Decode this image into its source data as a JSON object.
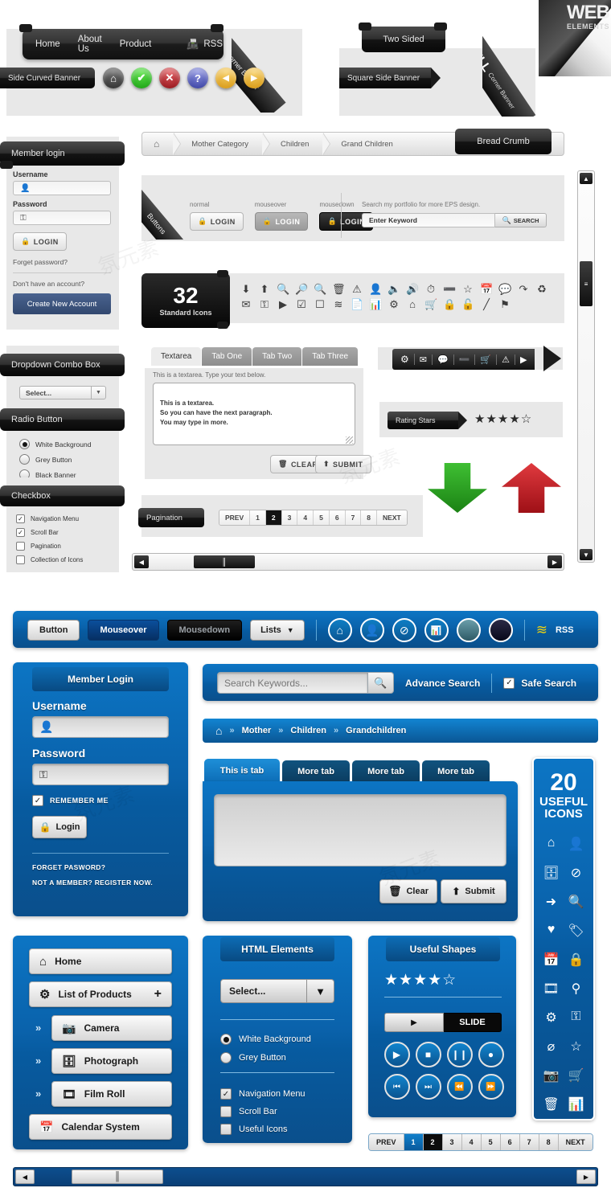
{
  "corner": {
    "title_line1": "WEB",
    "title_line2": "ELEMENTS"
  },
  "grey_kit": {
    "topnav": {
      "items": [
        "Home",
        "About Us",
        "Product"
      ],
      "rss_label": "RSS",
      "rss_icon": "rss-icon"
    },
    "banners": {
      "side_curved": "Side Curved Banner",
      "corner_left": "Corner Banner",
      "two_sided": "Two Sided",
      "square_side": "Square Side Banner",
      "corner_right_big": "FULL",
      "corner_right_small": "Corner Banner"
    },
    "circle_buttons": [
      {
        "name": "home-icon",
        "glyph": "⌂",
        "color": "#4a4a4a"
      },
      {
        "name": "check-icon",
        "glyph": "✔",
        "color": "#22b520"
      },
      {
        "name": "close-icon",
        "glyph": "✕",
        "color": "#a81b20"
      },
      {
        "name": "question-icon",
        "glyph": "?",
        "color": "#4a52b0"
      },
      {
        "name": "prev-icon",
        "glyph": "◀",
        "color": "#e2a51a"
      },
      {
        "name": "next-icon",
        "glyph": "▶",
        "color": "#e2a51a"
      }
    ],
    "login_panel": {
      "title": "Member login",
      "username_label": "Username",
      "username_icon": "user-icon",
      "password_label": "Password",
      "password_icon": "key-icon",
      "login_button": "LOGIN",
      "login_icon": "lock-icon",
      "forgot": "Forget password?",
      "no_account": "Don't have an account?",
      "create_account": "Create New Account",
      "accent": "#3a5488"
    },
    "dropdown": {
      "title": "Dropdown Combo Box",
      "value": "Select...",
      "arrow_icon": "chevron-down-icon"
    },
    "radio": {
      "title": "Radio Button",
      "options": [
        "White Background",
        "Grey Button",
        "Black Banner"
      ],
      "selected_index": 0
    },
    "checkbox": {
      "title": "Checkbox",
      "options": [
        {
          "label": "Navigation Menu",
          "checked": true
        },
        {
          "label": "Scroll Bar",
          "checked": true
        },
        {
          "label": "Pagination",
          "checked": false
        },
        {
          "label": "Collection of Icons",
          "checked": false
        }
      ]
    },
    "breadcrumb": {
      "home_icon": "home-icon",
      "items": [
        "Mother Category",
        "Children",
        "Grand Children"
      ],
      "tag": "Bread Crumb"
    },
    "buttons_block": {
      "ribbon": "Buttons",
      "states": [
        "normal",
        "mouseover",
        "mousedown"
      ],
      "button_label": "LOGIN",
      "search_caption": "Search my portfolio for more EPS design.",
      "search_placeholder": "Enter Keyword",
      "search_button": "SEARCH",
      "search_icon": "search-icon"
    },
    "icons32": {
      "count": "32",
      "caption": "Standard Icons",
      "glyphs": [
        "⬇",
        "⬆",
        "⊕",
        "⊖",
        "⚲",
        "🗑",
        "⚠",
        "♟",
        "🔊",
        "◂",
        "◴",
        "⊖",
        "☆",
        "📅",
        "💬",
        "↷",
        "♻",
        "✉",
        "⚷",
        "▶",
        "☑",
        "☐",
        "≋",
        "📄",
        "‖",
        "⚙",
        "⌂",
        "🛒",
        "🔒",
        "🔓",
        "∕",
        "⚑"
      ]
    },
    "textarea_block": {
      "tabs": [
        "Textarea",
        "Tab One",
        "Tab Two",
        "Tab Three"
      ],
      "active_tab": 0,
      "caption": "This is a textarea. Type your text below.",
      "value": "This is a textarea.\nSo you can have the next paragraph.\nYou may type in more.",
      "clear_label": "CLEAR",
      "clear_icon": "trash-icon",
      "submit_label": "SUBMIT",
      "submit_icon": "up-arrow-icon"
    },
    "nav_strip_icons": [
      "gear-icon",
      "mail-icon",
      "comment-icon",
      "minus-icon",
      "cart-icon",
      "warning-icon",
      "play-icon"
    ],
    "nav_strip_glyphs": [
      "⚙",
      "✉",
      "💬",
      "⊖",
      "🛒",
      "⚠",
      "▶"
    ],
    "rating": {
      "label": "Rating Stars",
      "value": 3.5,
      "max": 5
    },
    "arrows": {
      "down_color": "#2fae28",
      "up_color": "#c42026"
    },
    "pagination": {
      "label": "Pagination",
      "prev": "PREV",
      "next": "NEXT",
      "pages": [
        "1",
        "2",
        "3",
        "4",
        "5",
        "6",
        "7",
        "8"
      ],
      "current": "2"
    }
  },
  "blue_kit": {
    "toolbar": {
      "buttons": [
        "Button",
        "Mouseover",
        "Mousedown"
      ],
      "list_label": "Lists",
      "list_icon": "chevron-down-icon",
      "icons": [
        "home-icon",
        "user-icon",
        "no-entry-icon",
        "chart-icon",
        "circle-teal-icon",
        "circle-dark-icon"
      ],
      "icon_glyphs": [
        "⌂",
        "👤",
        "⊘",
        "📊",
        "",
        ""
      ],
      "rss_label": "RSS",
      "rss_icon": "rss-icon",
      "rss_color": "#f2d40c"
    },
    "login": {
      "title": "Member Login",
      "username_label": "Username",
      "username_icon": "user-icon",
      "password_label": "Password",
      "password_icon": "key-icon",
      "remember_label": "REMEMBER ME",
      "remember_checked": true,
      "login_button": "Login",
      "login_icon": "lock-icon",
      "forgot": "FORGET PASWORD?",
      "register": "NOT A MEMBER? REGISTER NOW."
    },
    "search": {
      "placeholder": "Search Keywords...",
      "search_icon": "search-icon",
      "advance_label": "Advance Search",
      "safe_label": "Safe Search",
      "safe_checked": true
    },
    "breadcrumb": {
      "home_icon": "home-icon",
      "separator": "»",
      "items": [
        "Mother",
        "Children",
        "Grandchildren"
      ]
    },
    "tabs_panel": {
      "tabs": [
        "This is tab",
        "More tab",
        "More tab",
        "More tab"
      ],
      "active_tab": 0,
      "textarea_value": "",
      "clear_label": "Clear",
      "clear_icon": "trash-icon",
      "submit_label": "Submit",
      "submit_icon": "up-arrow-icon"
    },
    "useful_icons": {
      "count": "20",
      "line1": "USEFUL",
      "line2": "ICONS",
      "names": [
        "home-icon",
        "user-icon",
        "photo-upload-icon",
        "no-entry-icon",
        "arrow-right-icon",
        "search-icon",
        "heart-icon",
        "tag-icon",
        "calendar-icon",
        "lock-icon",
        "film-roll-icon",
        "sitemap-icon",
        "gear-icon",
        "key-icon",
        "block-icon",
        "star-icon",
        "camera-icon",
        "basket-icon",
        "trash-icon",
        "chart-icon"
      ],
      "glyphs": [
        "⌂",
        "👤",
        "⬆",
        "⊘",
        "➡",
        "🔍",
        "♥",
        "🏷",
        "📅",
        "🔒",
        "▓",
        "⑂",
        "⚙",
        "⚷",
        "⊘",
        "★",
        "📷",
        "🧺",
        "🗑",
        "📊"
      ]
    },
    "sidemenu": {
      "items": [
        {
          "label": "Home",
          "icon": "home-icon",
          "glyph": "⌂",
          "sub": false,
          "plus": false
        },
        {
          "label": "List of Products",
          "icon": "gear-icon",
          "glyph": "⚙",
          "sub": false,
          "plus": true
        },
        {
          "label": "Camera",
          "icon": "camera-icon",
          "glyph": "📷",
          "sub": true,
          "plus": false
        },
        {
          "label": "Photograph",
          "icon": "photo-icon",
          "glyph": "🖼",
          "sub": true,
          "plus": false
        },
        {
          "label": "Film Roll",
          "icon": "film-roll-icon",
          "glyph": "🎞",
          "sub": true,
          "plus": false
        },
        {
          "label": "Calendar System",
          "icon": "calendar-icon",
          "glyph": "📅",
          "sub": false,
          "plus": false
        }
      ],
      "sub_marker": "»",
      "plus_marker": "+"
    },
    "html_elements": {
      "title": "HTML Elements",
      "select_value": "Select...",
      "select_icon": "chevron-down-icon",
      "radios": [
        {
          "label": "White Background",
          "selected": true
        },
        {
          "label": "Grey Button",
          "selected": false
        }
      ],
      "checks": [
        {
          "label": "Navigation Menu",
          "checked": true
        },
        {
          "label": "Scroll Bar",
          "checked": false
        },
        {
          "label": "Useful Icons",
          "checked": false
        }
      ]
    },
    "useful_shapes": {
      "title": "Useful Shapes",
      "rating": 3.5,
      "rating_max": 5,
      "slide_label": "SLIDE",
      "slide_icon": "play-icon",
      "media_icons": [
        "play-icon",
        "stop-icon",
        "pause-icon",
        "record-icon",
        "skip-back-icon",
        "skip-forward-icon",
        "rewind-icon",
        "fast-forward-icon"
      ],
      "media_glyphs": [
        "▶",
        "■",
        "▐▌",
        "●",
        "⏮",
        "⏭",
        "⏪",
        "⏩"
      ]
    },
    "pagination": {
      "prev": "PREV",
      "next": "NEXT",
      "pages": [
        "1",
        "2",
        "3",
        "4",
        "5",
        "6",
        "7",
        "8"
      ],
      "blue_active": "1",
      "black_active": "2"
    },
    "scrollbar": {
      "left_icon": "left-arrow-icon",
      "right_icon": "right-arrow-icon",
      "grip_icon": "grip-icon"
    }
  }
}
